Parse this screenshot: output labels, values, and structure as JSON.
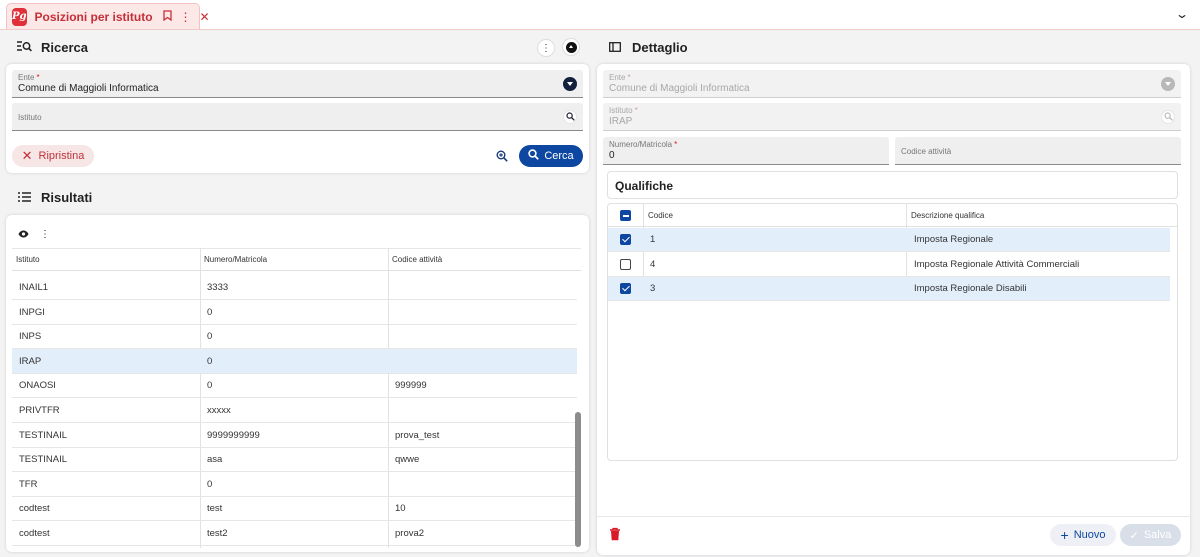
{
  "tab": {
    "logo": "Pg",
    "title": "Posizioni per istituto"
  },
  "ricerca": {
    "title": "Ricerca",
    "ente_label": "Ente",
    "ente_value": "Comune di Maggioli Informatica",
    "istituto_placeholder": "Istituto",
    "ripristina_label": "Ripristina",
    "cerca_label": "Cerca"
  },
  "risultati": {
    "title": "Risultati",
    "columns": [
      "Istituto",
      "Numero/Matricola",
      "Codice attività"
    ],
    "rows": [
      {
        "istituto": "INAIL1",
        "matricola": "3333",
        "codice": ""
      },
      {
        "istituto": "INPGI",
        "matricola": "0",
        "codice": ""
      },
      {
        "istituto": "INPS",
        "matricola": "0",
        "codice": ""
      },
      {
        "istituto": "IRAP",
        "matricola": "0",
        "codice": "",
        "selected": true
      },
      {
        "istituto": "ONAOSI",
        "matricola": "0",
        "codice": "999999"
      },
      {
        "istituto": "PRIVTFR",
        "matricola": "xxxxx",
        "codice": ""
      },
      {
        "istituto": "TESTINAIL",
        "matricola": "9999999999",
        "codice": "prova_test"
      },
      {
        "istituto": "TESTINAIL",
        "matricola": "asa",
        "codice": "qwwe"
      },
      {
        "istituto": "TFR",
        "matricola": "0",
        "codice": ""
      },
      {
        "istituto": "codtest",
        "matricola": "test",
        "codice": "10"
      },
      {
        "istituto": "codtest",
        "matricola": "test2",
        "codice": "prova2"
      }
    ]
  },
  "dettaglio": {
    "title": "Dettaglio",
    "ente_label": "Ente",
    "ente_value": "Comune di Maggioli Informatica",
    "istituto_label": "Istituto",
    "istituto_value": "IRAP",
    "matricola_label": "Numero/Matricola",
    "matricola_value": "0",
    "codice_attivita_label": "Codice attività",
    "nuovo_label": "Nuovo",
    "salva_label": "Salva"
  },
  "qualifiche": {
    "title": "Qualifiche",
    "columns": [
      "Codice",
      "Descrizione qualifica"
    ],
    "rows": [
      {
        "codice": "1",
        "descrizione": "Imposta Regionale",
        "checked": true
      },
      {
        "codice": "4",
        "descrizione": "Imposta Regionale Attività Commerciali",
        "checked": false
      },
      {
        "codice": "3",
        "descrizione": "Imposta Regionale Disabili",
        "checked": true
      }
    ]
  },
  "colors": {
    "brand": "#e0313b",
    "primary": "#0d47a1",
    "selected_row": "#e3eefb",
    "danger": "#c0313a"
  }
}
